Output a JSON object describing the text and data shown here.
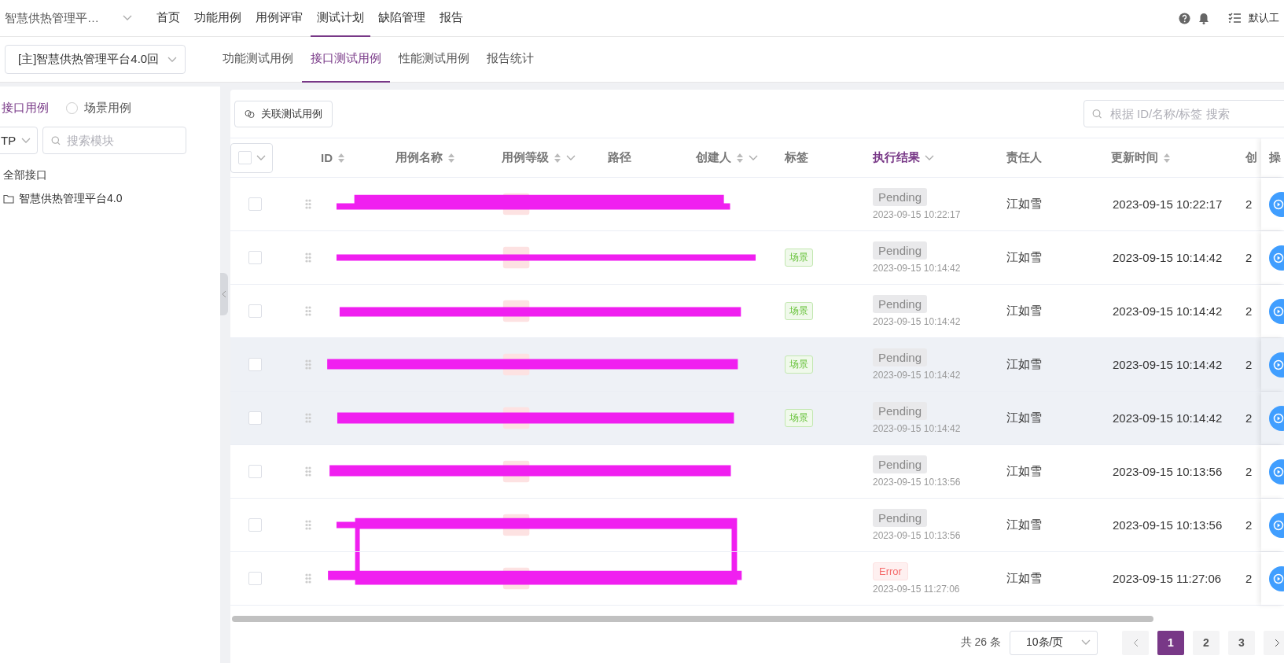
{
  "nav": {
    "project": "智慧供热管理平…",
    "items": [
      {
        "label": "首页",
        "selected": false
      },
      {
        "label": "功能用例",
        "selected": false
      },
      {
        "label": "用例评审",
        "selected": false
      },
      {
        "label": "测试计划",
        "selected": true
      },
      {
        "label": "缺陷管理",
        "selected": false
      },
      {
        "label": "报告",
        "selected": false
      }
    ],
    "workspace": "默认工"
  },
  "subbar": {
    "version": "[主]智慧供热管理平台4.0回",
    "tabs": [
      {
        "label": "功能测试用例",
        "selected": false
      },
      {
        "label": "接口测试用例",
        "selected": true
      },
      {
        "label": "性能测试用例",
        "selected": false
      },
      {
        "label": "报告统计",
        "selected": false
      }
    ]
  },
  "sidebar": {
    "types": [
      {
        "label": "接口用例",
        "selected": true
      },
      {
        "label": "场景用例",
        "selected": false
      }
    ],
    "protocol": "TP",
    "search_placeholder": "搜索模块",
    "tree": [
      {
        "label": "全部接口",
        "children": [
          {
            "label": "智慧供热管理平台4.0"
          }
        ]
      }
    ]
  },
  "panel": {
    "link_button": "关联测试用例",
    "search_placeholder": "根据 ID/名称/标签 搜索",
    "columns": [
      {
        "label": "ID",
        "kind": "sort",
        "active": false
      },
      {
        "label": "用例名称",
        "kind": "sort",
        "active": false
      },
      {
        "label": "用例等级",
        "kind": "sort_filter",
        "active": false
      },
      {
        "label": "路径",
        "kind": "plain",
        "active": false
      },
      {
        "label": "创建人",
        "kind": "sort_filter",
        "active": false
      },
      {
        "label": "标签",
        "kind": "plain",
        "active": false
      },
      {
        "label": "执行结果",
        "kind": "filter",
        "active": true
      },
      {
        "label": "责任人",
        "kind": "plain",
        "active": false
      },
      {
        "label": "更新时间",
        "kind": "sort",
        "active": false
      },
      {
        "label": "创",
        "kind": "plain",
        "active": false
      }
    ],
    "ops_header": "操",
    "rows": [
      {
        "checked": false,
        "hovered": false,
        "tag": null,
        "status": {
          "kind": "pending",
          "label": "Pending"
        },
        "run_time": "2023-09-15 10:22:17",
        "owner": "江如雪",
        "updated": "2023-09-15 10:22:17",
        "created": "2"
      },
      {
        "checked": false,
        "hovered": false,
        "tag": "场景",
        "status": {
          "kind": "pending",
          "label": "Pending"
        },
        "run_time": "2023-09-15 10:14:42",
        "owner": "江如雪",
        "updated": "2023-09-15 10:14:42",
        "created": "2"
      },
      {
        "checked": false,
        "hovered": false,
        "tag": "场景",
        "status": {
          "kind": "pending",
          "label": "Pending"
        },
        "run_time": "2023-09-15 10:14:42",
        "owner": "江如雪",
        "updated": "2023-09-15 10:14:42",
        "created": "2"
      },
      {
        "checked": false,
        "hovered": true,
        "tag": "场景",
        "status": {
          "kind": "pending",
          "label": "Pending"
        },
        "run_time": "2023-09-15 10:14:42",
        "owner": "江如雪",
        "updated": "2023-09-15 10:14:42",
        "created": "2"
      },
      {
        "checked": false,
        "hovered": true,
        "tag": "场景",
        "status": {
          "kind": "pending",
          "label": "Pending"
        },
        "run_time": "2023-09-15 10:14:42",
        "owner": "江如雪",
        "updated": "2023-09-15 10:14:42",
        "created": "2"
      },
      {
        "checked": false,
        "hovered": false,
        "tag": null,
        "status": {
          "kind": "pending",
          "label": "Pending"
        },
        "run_time": "2023-09-15 10:13:56",
        "owner": "江如雪",
        "updated": "2023-09-15 10:13:56",
        "created": "2"
      },
      {
        "checked": false,
        "hovered": false,
        "tag": null,
        "status": {
          "kind": "pending",
          "label": "Pending"
        },
        "run_time": "2023-09-15 10:13:56",
        "owner": "江如雪",
        "updated": "2023-09-15 10:13:56",
        "created": "2"
      },
      {
        "checked": false,
        "hovered": false,
        "tag": null,
        "status": {
          "kind": "error",
          "label": "Error"
        },
        "run_time": "2023-09-15 11:27:06",
        "owner": "江如雪",
        "updated": "2023-09-15 11:27:06",
        "created": "2"
      }
    ],
    "pagination": {
      "total": "共 26 条",
      "page_size": "10条/页",
      "pages": [
        {
          "label": "1",
          "selected": true
        },
        {
          "label": "2",
          "selected": false
        },
        {
          "label": "3",
          "selected": false
        }
      ]
    }
  }
}
